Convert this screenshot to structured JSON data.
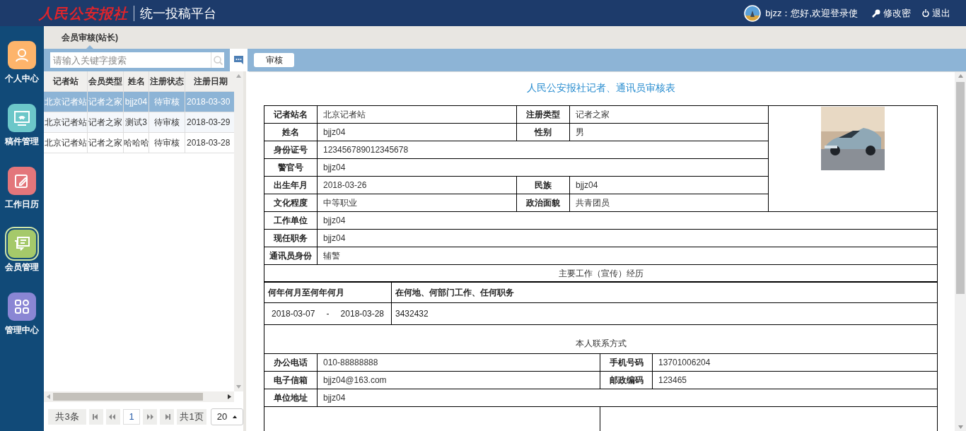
{
  "header": {
    "logo": "人民公安报社",
    "title": "统一投稿平台",
    "greeting": "bjzz：您好,欢迎登录使",
    "change_password": "修改密",
    "logout": "退出"
  },
  "sidebar": [
    {
      "label": "个人中心",
      "kind": "person",
      "color": "#fdb46b",
      "selected": false
    },
    {
      "label": "稿件管理",
      "kind": "monitor",
      "color": "#6cc7c9",
      "selected": false
    },
    {
      "label": "工作日历",
      "kind": "calendar",
      "color": "#e3767b",
      "selected": false
    },
    {
      "label": "会员管理",
      "kind": "chat",
      "color": "#a5c96a",
      "selected": true
    },
    {
      "label": "管理中心",
      "kind": "grid",
      "color": "#8a86d4",
      "selected": false
    }
  ],
  "tab": {
    "label": "会员审核(站长)"
  },
  "search": {
    "placeholder": "请输入关键字搜索"
  },
  "toolbar": {
    "button": "审核"
  },
  "grid": {
    "columns": [
      "记者站",
      "会员类型",
      "姓名",
      "注册状态",
      "注册日期"
    ],
    "rows": [
      {
        "cells": [
          "北京记者站",
          "记者之家",
          "bjjz04",
          "待审核",
          "2018-03-30"
        ],
        "selected": true
      },
      {
        "cells": [
          "北京记者站",
          "记者之家",
          "测试3",
          "待审核",
          "2018-03-29"
        ],
        "selected": false
      },
      {
        "cells": [
          "北京记者站",
          "记者之家",
          "哈哈哈",
          "待审核",
          "2018-03-28"
        ],
        "selected": false
      }
    ]
  },
  "pager": {
    "total": "共3条",
    "page": "1",
    "pages": "共1页",
    "page_size": "20"
  },
  "form": {
    "title": "人民公安报社记者、通讯员审核表",
    "fields": [
      {
        "label": "记者站名",
        "value": "北京记者站"
      },
      {
        "label": "注册类型",
        "value": "记者之家"
      },
      {
        "label": "姓名",
        "value": "bjjz04"
      },
      {
        "label": "性别",
        "value": "男"
      },
      {
        "label": "身份证号",
        "value": "123456789012345678"
      },
      {
        "label": "警官号",
        "value": "bjjz04"
      },
      {
        "label": "出生年月",
        "value": "2018-03-26"
      },
      {
        "label": "民族",
        "value": "bjjz04"
      },
      {
        "label": "文化程度",
        "value": "中等职业"
      },
      {
        "label": "政治面貌",
        "value": "共青团员"
      },
      {
        "label": "工作单位",
        "value": "bjjz04"
      },
      {
        "label": "现任职务",
        "value": "bjjz04"
      },
      {
        "label": "通讯员身份",
        "value": "辅警"
      }
    ],
    "work_title": "主要工作（宣传）经历",
    "work_columns": [
      "何年何月至何年何月",
      "在何地、何部门工作、任何职务"
    ],
    "work_rows": [
      {
        "from": "2018-03-07",
        "sep": "-",
        "to": "2018-03-28",
        "detail": "3432432"
      }
    ],
    "contact_title": "本人联系方式",
    "contact": [
      {
        "label": "办公电话",
        "value": "010-88888888"
      },
      {
        "label": "手机号码",
        "value": "13701006204"
      },
      {
        "label": "电子信箱",
        "value": "bjjz04@163.com"
      },
      {
        "label": "邮政编码",
        "value": "123465"
      },
      {
        "label": "单位地址",
        "value": "bjjz04"
      }
    ]
  }
}
